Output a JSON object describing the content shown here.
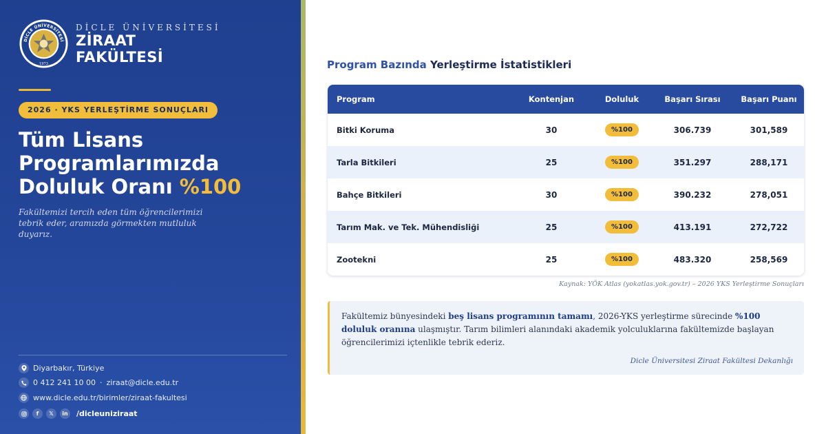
{
  "brand": {
    "university": "DİCLE ÜNİVERSİTESİ",
    "faculty_line1": "ZİRAAT",
    "faculty_line2": "FAKÜLTESİ",
    "seal_text": "DİCLE ÜNİVERSİTESİ",
    "seal_year": "1973",
    "colors": {
      "navy": "#24469a",
      "gold": "#f2bd3a"
    }
  },
  "badge": "2026 · YKS YERLEŞTİRME SONUÇLARI",
  "headline": {
    "line1": "Tüm Lisans",
    "line2": "Programlarımızda",
    "line3_prefix": "Doluluk Oranı ",
    "line3_accent": "%100"
  },
  "subtext": "Fakültemizi tercih eden tüm öğrencilerimizi tebrik eder, aramızda görmekten mutluluk duyarız.",
  "contact": {
    "location": "Diyarbakır, Türkiye",
    "phone": "0 412 241 10 00",
    "sep": "·",
    "email": "ziraat@dicle.edu.tr",
    "website": "www.dicle.edu.tr/birimler/ziraat-fakultesi",
    "social_handle": "/dicleuniziraat",
    "icons": [
      "location-icon",
      "phone-icon",
      "globe-icon",
      "instagram-icon",
      "facebook-icon",
      "x-icon",
      "linkedin-icon"
    ]
  },
  "section": {
    "title_blue": "Program Bazında",
    "title_rest": " Yerleştirme İstatistikleri"
  },
  "table": {
    "headers": [
      "Program",
      "Kontenjan",
      "Doluluk",
      "Başarı Sırası",
      "Başarı Puanı"
    ],
    "rows": [
      {
        "program": "Bitki Koruma",
        "quota": "30",
        "fill": "%100",
        "rank": "306.739",
        "score": "301,589"
      },
      {
        "program": "Tarla Bitkileri",
        "quota": "25",
        "fill": "%100",
        "rank": "351.297",
        "score": "288,171"
      },
      {
        "program": "Bahçe Bitkileri",
        "quota": "30",
        "fill": "%100",
        "rank": "390.232",
        "score": "278,051"
      },
      {
        "program": "Tarım Mak. ve Tek. Mühendisliği",
        "quota": "25",
        "fill": "%100",
        "rank": "413.191",
        "score": "272,722"
      },
      {
        "program": "Zootekni",
        "quota": "25",
        "fill": "%100",
        "rank": "483.320",
        "score": "258,569"
      }
    ]
  },
  "source": "Kaynak: YÖK Atlas (yokatlas.yok.gov.tr) – 2026 YKS Yerleştirme Sonuçları",
  "note": {
    "t1": "Fakültemiz bünyesindeki ",
    "b1": "beş lisans programının tamamı",
    "t2": ", 2026-YKS yerleştirme sürecinde ",
    "b2": "%100 doluluk oranına",
    "t3": " ulaşmıştır. Tarım bilimleri alanındaki akademik yolculuklarına fakültemizde başlayan öğrencilerimizi içtenlikle tebrik ederiz.",
    "signature": "Dicle Üniversitesi Ziraat Fakültesi Dekanlığı"
  }
}
